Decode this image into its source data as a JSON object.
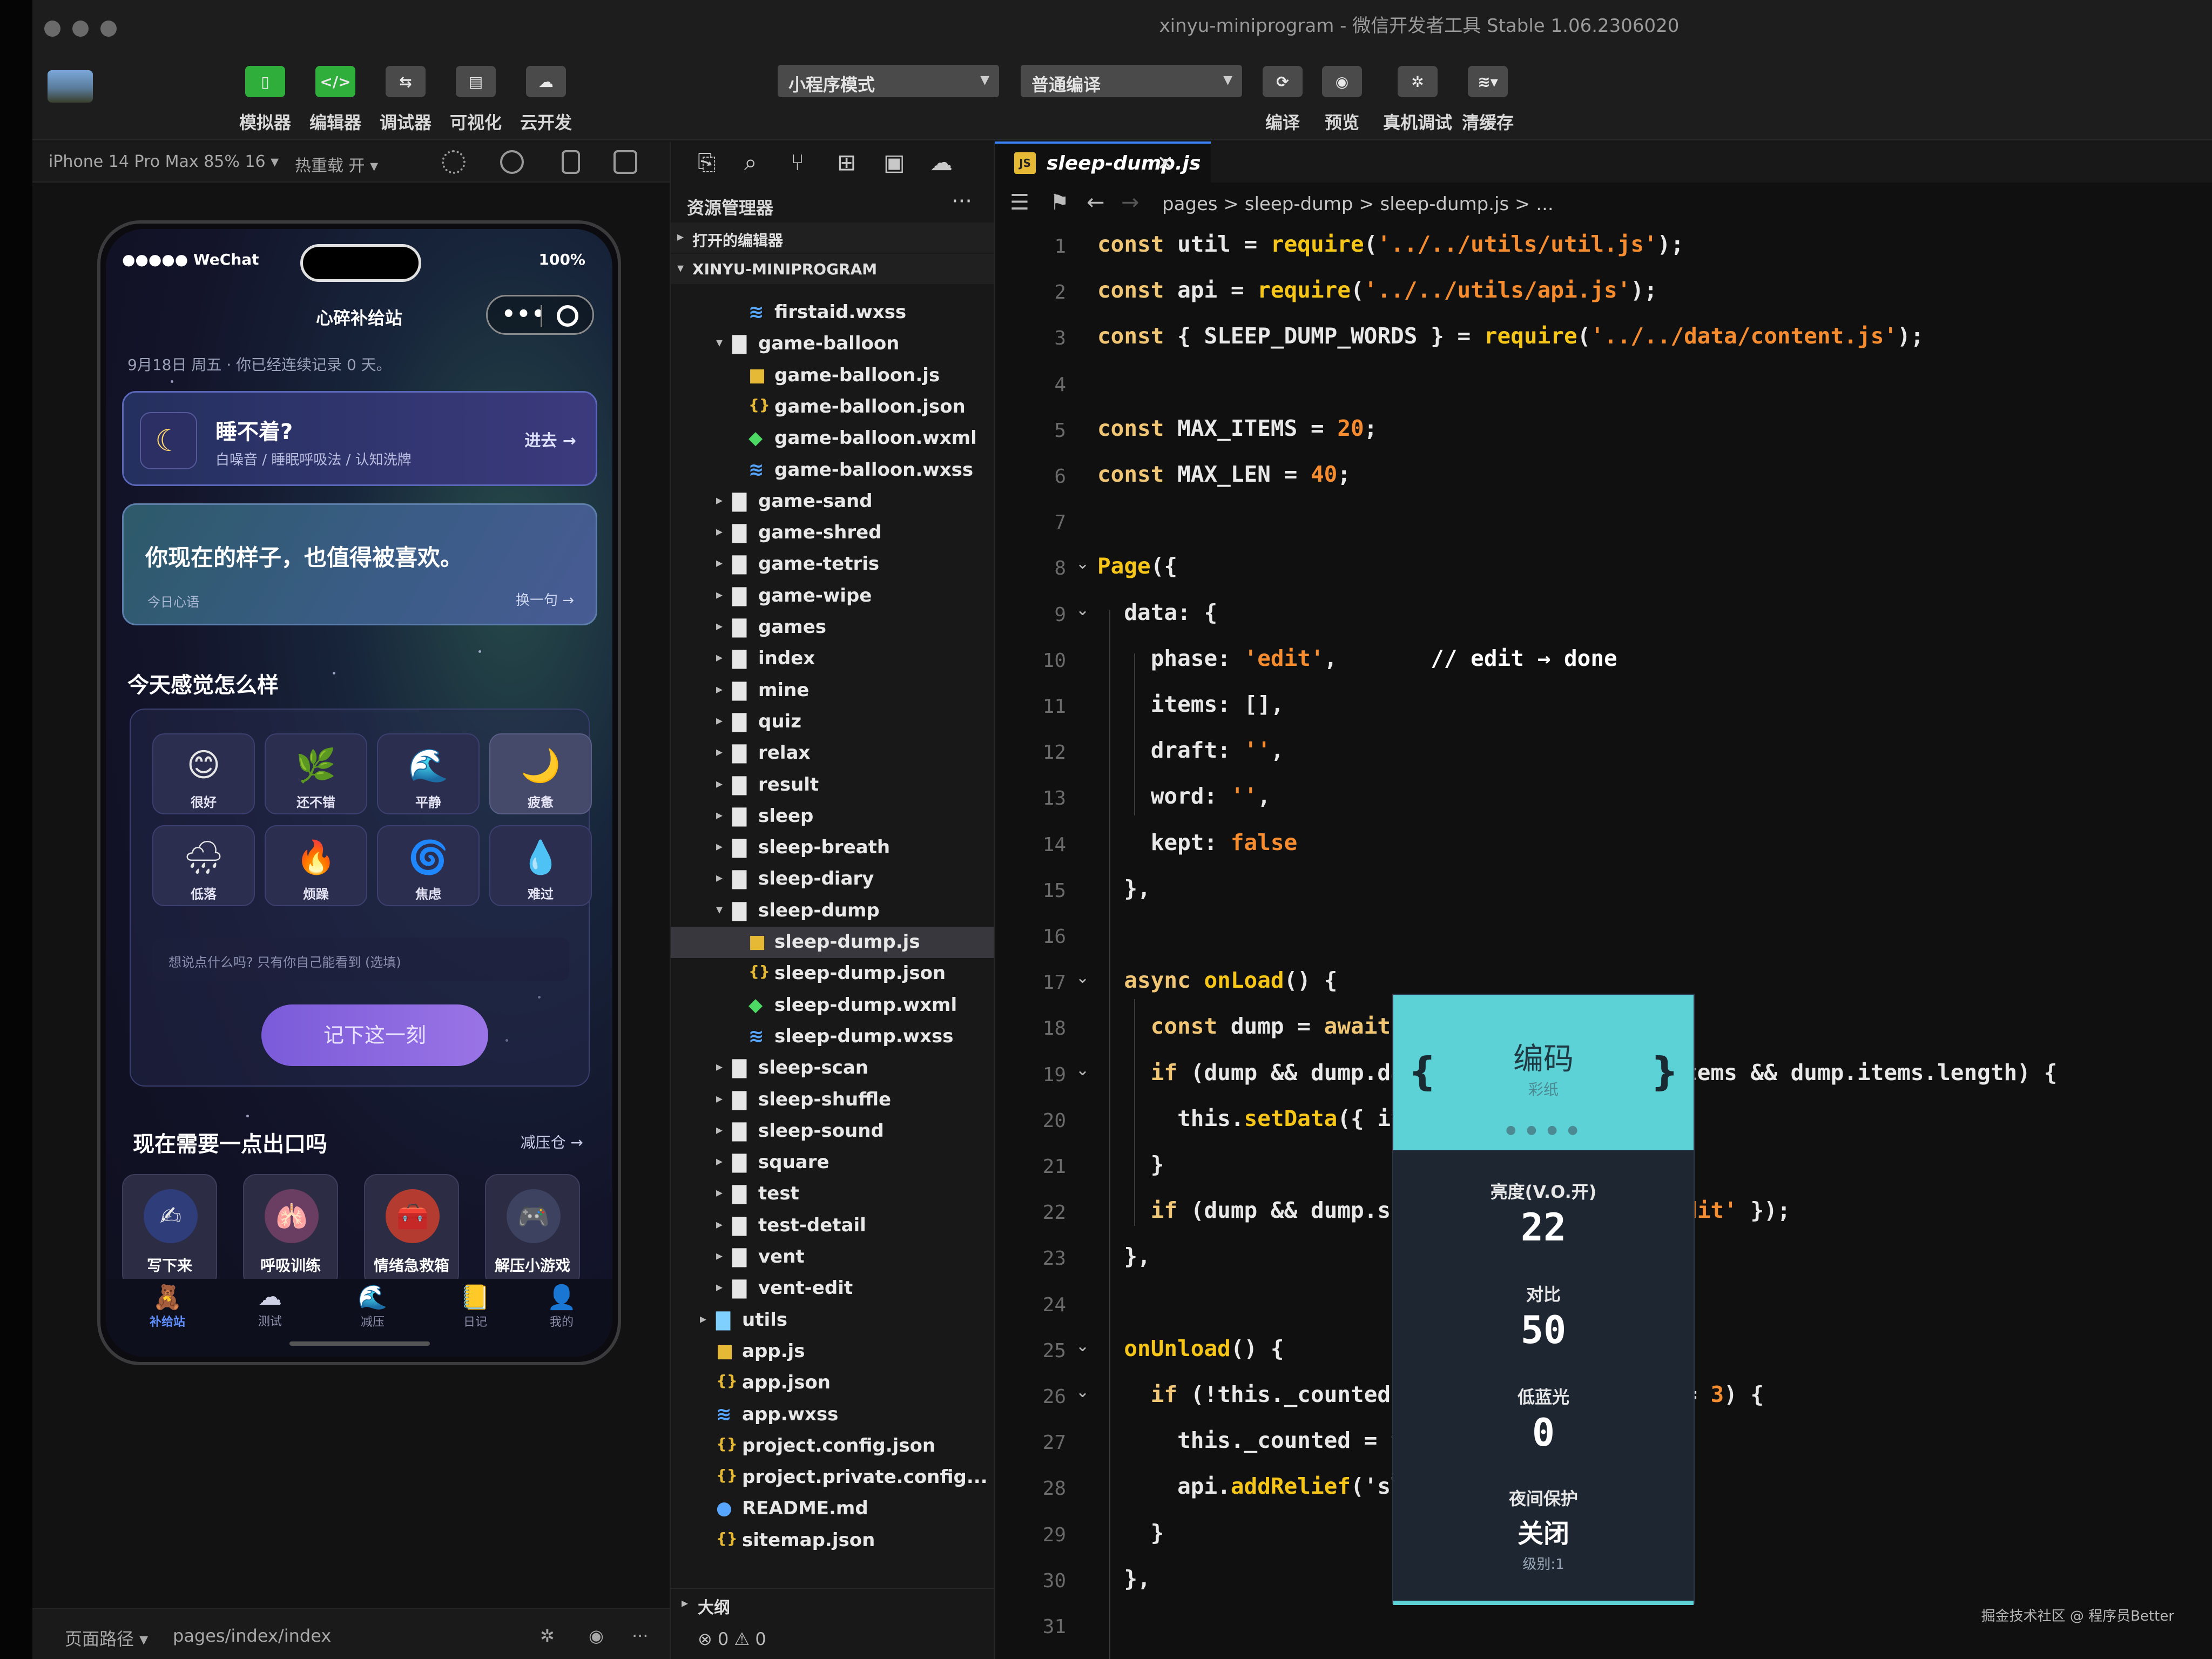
{
  "window": {
    "title": "xinyu-miniprogram - 微信开发者工具 Stable 1.06.2306020"
  },
  "toolbar": {
    "buttons": [
      {
        "label": "模拟器",
        "icon": "phone-icon"
      },
      {
        "label": "编辑器",
        "icon": "code-icon"
      },
      {
        "label": "调试器",
        "icon": "debugger-icon"
      },
      {
        "label": "可视化",
        "icon": "visual-icon"
      },
      {
        "label": "云开发",
        "icon": "cloud-icon"
      }
    ],
    "mode_select": "小程序模式",
    "compile_select": "普通编译",
    "actions": [
      "编译",
      "预览",
      "真机调试",
      "清缓存"
    ]
  },
  "simulator": {
    "device": "iPhone 14 Pro Max 85% 16 ▾",
    "hot_reload": "热重载 开 ▾",
    "status_left": "●●●●● WeChat",
    "status_right": "100%",
    "nav_title": "心碎补给站",
    "date_line": "9月18日 周五 · 你已经连续记录 0 天。",
    "card_sleep": {
      "title": "睡不着?",
      "subtitle": "白噪音 / 睡眠呼吸法 / 认知洗牌",
      "action": "进去 →"
    },
    "card_quote": {
      "text": "你现在的样子，也值得被喜欢。",
      "label": "今日心语",
      "action": "换一句 →"
    },
    "mood_title": "今天感觉怎么样",
    "moods": [
      {
        "emoji": "😊",
        "label": "很好"
      },
      {
        "emoji": "🌿",
        "label": "还不错"
      },
      {
        "emoji": "🌊",
        "label": "平静"
      },
      {
        "emoji": "🌙",
        "label": "疲惫"
      },
      {
        "emoji": "🌧",
        "label": "低落"
      },
      {
        "emoji": "🔥",
        "label": "烦躁"
      },
      {
        "emoji": "🌀",
        "label": "焦虑"
      },
      {
        "emoji": "💧",
        "label": "难过"
      }
    ],
    "note_placeholder": "想说点什么吗? 只有你自己能看到 (选填)",
    "submit_label": "记下这一刻",
    "need_title": "现在需要一点出口吗",
    "need_link": "减压仓 →",
    "tools": [
      {
        "emoji": "✍",
        "label": "写下来"
      },
      {
        "emoji": "🫁",
        "label": "呼吸训练"
      },
      {
        "emoji": "🧰",
        "label": "情绪急救箱"
      },
      {
        "emoji": "🎮",
        "label": "解压小游戏"
      }
    ],
    "tabs": [
      {
        "icon": "🧸",
        "label": "补给站"
      },
      {
        "icon": "☁",
        "label": "测试"
      },
      {
        "icon": "🌊",
        "label": "减压"
      },
      {
        "icon": "📒",
        "label": "日记"
      },
      {
        "icon": "👤",
        "label": "我的"
      }
    ],
    "page_path_label": "页面路径 ▾",
    "page_path": "pages/index/index"
  },
  "explorer": {
    "title": "资源管理器",
    "open_editors": "打开的编辑器",
    "project": "XINYU-MINIPROGRAM",
    "tree": [
      {
        "name": "firstaid.wxss",
        "type": "wxss",
        "depth": 2
      },
      {
        "name": "game-balloon",
        "type": "folder-open",
        "depth": 1
      },
      {
        "name": "game-balloon.js",
        "type": "js",
        "depth": 2
      },
      {
        "name": "game-balloon.json",
        "type": "json",
        "depth": 2
      },
      {
        "name": "game-balloon.wxml",
        "type": "wxml",
        "depth": 2
      },
      {
        "name": "game-balloon.wxss",
        "type": "wxss",
        "depth": 2
      },
      {
        "name": "game-sand",
        "type": "folder",
        "depth": 1
      },
      {
        "name": "game-shred",
        "type": "folder",
        "depth": 1
      },
      {
        "name": "game-tetris",
        "type": "folder",
        "depth": 1
      },
      {
        "name": "game-wipe",
        "type": "folder",
        "depth": 1
      },
      {
        "name": "games",
        "type": "folder",
        "depth": 1
      },
      {
        "name": "index",
        "type": "folder",
        "depth": 1
      },
      {
        "name": "mine",
        "type": "folder",
        "depth": 1
      },
      {
        "name": "quiz",
        "type": "folder",
        "depth": 1
      },
      {
        "name": "relax",
        "type": "folder",
        "depth": 1
      },
      {
        "name": "result",
        "type": "folder",
        "depth": 1
      },
      {
        "name": "sleep",
        "type": "folder",
        "depth": 1
      },
      {
        "name": "sleep-breath",
        "type": "folder",
        "depth": 1
      },
      {
        "name": "sleep-diary",
        "type": "folder",
        "depth": 1
      },
      {
        "name": "sleep-dump",
        "type": "folder-open",
        "depth": 1
      },
      {
        "name": "sleep-dump.js",
        "type": "js",
        "depth": 2,
        "selected": true
      },
      {
        "name": "sleep-dump.json",
        "type": "json",
        "depth": 2
      },
      {
        "name": "sleep-dump.wxml",
        "type": "wxml",
        "depth": 2
      },
      {
        "name": "sleep-dump.wxss",
        "type": "wxss",
        "depth": 2
      },
      {
        "name": "sleep-scan",
        "type": "folder",
        "depth": 1
      },
      {
        "name": "sleep-shuffle",
        "type": "folder",
        "depth": 1
      },
      {
        "name": "sleep-sound",
        "type": "folder",
        "depth": 1
      },
      {
        "name": "square",
        "type": "folder",
        "depth": 1
      },
      {
        "name": "test",
        "type": "folder",
        "depth": 1
      },
      {
        "name": "test-detail",
        "type": "folder",
        "depth": 1
      },
      {
        "name": "vent",
        "type": "folder",
        "depth": 1
      },
      {
        "name": "vent-edit",
        "type": "folder",
        "depth": 1
      },
      {
        "name": "utils",
        "type": "folder-special",
        "depth": 0
      },
      {
        "name": "app.js",
        "type": "js",
        "depth": 0
      },
      {
        "name": "app.json",
        "type": "json",
        "depth": 0
      },
      {
        "name": "app.wxss",
        "type": "wxss",
        "depth": 0
      },
      {
        "name": "project.config.json",
        "type": "json",
        "depth": 0
      },
      {
        "name": "project.private.config...",
        "type": "json",
        "depth": 0
      },
      {
        "name": "README.md",
        "type": "md",
        "depth": 0
      },
      {
        "name": "sitemap.json",
        "type": "json",
        "depth": 0
      }
    ],
    "outline": "大纲",
    "problems": "⊗ 0 ⚠ 0"
  },
  "editor": {
    "tab": "sleep-dump.js",
    "breadcrumb": "pages > sleep-dump > sleep-dump.js > ...",
    "lines": [
      {
        "n": "1",
        "code": "const util = require('../../utils/util.js');"
      },
      {
        "n": "2",
        "code": "const api = require('../../utils/api.js');"
      },
      {
        "n": "3",
        "code": "const { SLEEP_DUMP_WORDS } = require('../../data/content.js');"
      },
      {
        "n": "4",
        "code": ""
      },
      {
        "n": "5",
        "code": "const MAX_ITEMS = 20;"
      },
      {
        "n": "6",
        "code": "const MAX_LEN = 40;"
      },
      {
        "n": "7",
        "code": ""
      },
      {
        "n": "8",
        "code": "Page({",
        "fold": true
      },
      {
        "n": "9",
        "code": "  data: {",
        "fold": true
      },
      {
        "n": "10",
        "code": "    phase: 'edit',       // edit → done"
      },
      {
        "n": "11",
        "code": "    items: [],"
      },
      {
        "n": "12",
        "code": "    draft: '',"
      },
      {
        "n": "13",
        "code": "    word: '',"
      },
      {
        "n": "14",
        "code": "    kept: false"
      },
      {
        "n": "15",
        "code": "  },"
      },
      {
        "n": "16",
        "code": ""
      },
      {
        "n": "17",
        "code": "  async onLoad() {",
        "fold": true
      },
      {
        "n": "18",
        "code": "    const dump = await a"
      },
      {
        "n": "19",
        "code": "    if (dump && dump.dat                   items && dump.items.length) {",
        "fold": true
      },
      {
        "n": "20",
        "code": "      this.setData({ ite"
      },
      {
        "n": "21",
        "code": "    }"
      },
      {
        "n": "22",
        "code": "    if (dump && dump.sho                  'edit' });"
      },
      {
        "n": "23",
        "code": "  },"
      },
      {
        "n": "24",
        "code": ""
      },
      {
        "n": "25",
        "code": "  onUnload() {",
        "fold": true
      },
      {
        "n": "26",
        "code": "    if (!this._counted &                   >= 3) {",
        "fold": true
      },
      {
        "n": "27",
        "code": "      this._counted = tr"
      },
      {
        "n": "28",
        "code": "      api.addRelief('sle"
      },
      {
        "n": "29",
        "code": "    }"
      },
      {
        "n": "30",
        "code": "  },"
      },
      {
        "n": "31",
        "code": ""
      }
    ]
  },
  "monitor_menu": {
    "title": "编码",
    "subtitle": "彩纸",
    "dots": "● ● ● ●",
    "options": [
      {
        "label": "亮度(V.O.开)",
        "value": "22"
      },
      {
        "label": "对比",
        "value": "50"
      },
      {
        "label": "低蓝光",
        "value": "0"
      },
      {
        "label": "夜间保护",
        "value": "关闭",
        "sub": "级别:1"
      }
    ]
  },
  "watermark": "掘金技术社区 @ 程序员Better"
}
